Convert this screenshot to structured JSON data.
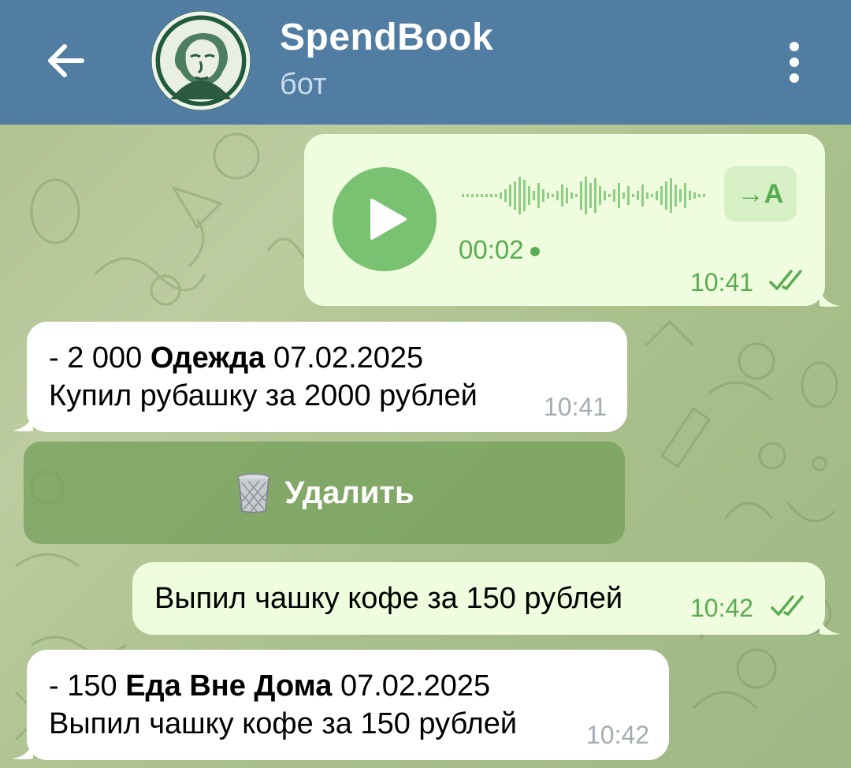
{
  "header": {
    "title": "SpendBook",
    "subtitle": "бот"
  },
  "messages": {
    "voice": {
      "duration": "00:02",
      "transcribe_label": "→A",
      "time": "10:41"
    },
    "bot1": {
      "amount": "- 2 000",
      "category": "Одежда",
      "date": "07.02.2025",
      "note": "Купил рубашку за 2000 рублей",
      "time": "10:41"
    },
    "delete_button": {
      "label": "Удалить"
    },
    "user2": {
      "text": "Выпил чашку кофе за 150 рублей",
      "time": "10:42"
    },
    "bot2": {
      "amount": "- 150",
      "category": "Еда Вне Дома",
      "date": "07.02.2025",
      "note": "Выпил чашку кофе за 150 рублей",
      "time": "10:42"
    }
  },
  "colors": {
    "header": "#517da2",
    "outgoing_bubble": "#effdde",
    "incoming_bubble": "#ffffff",
    "accent_green": "#5aab52",
    "play_button": "#78c272"
  },
  "icons": {
    "back": "arrow-left-icon",
    "menu": "more-vertical-icon",
    "play": "play-icon",
    "read": "double-check-icon",
    "delete": "trash-icon"
  }
}
